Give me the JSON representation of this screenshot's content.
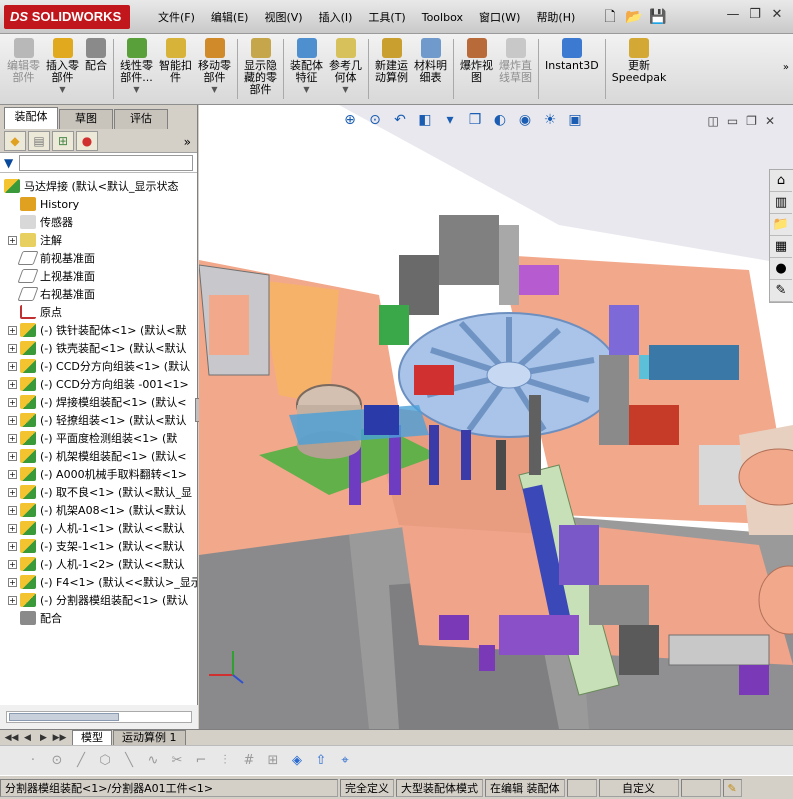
{
  "app": {
    "logo_prefix": "DS",
    "logo_text": "SOLIDWORKS",
    "brand_color": "#c0161c"
  },
  "menu": [
    {
      "id": "file",
      "label": "文件(F)"
    },
    {
      "id": "edit",
      "label": "编辑(E)"
    },
    {
      "id": "view",
      "label": "视图(V)"
    },
    {
      "id": "insert",
      "label": "插入(I)"
    },
    {
      "id": "tools",
      "label": "工具(T)"
    },
    {
      "id": "toolbox",
      "label": "Toolbox"
    },
    {
      "id": "window",
      "label": "窗口(W)"
    },
    {
      "id": "help",
      "label": "帮助(H)"
    }
  ],
  "quick_access": [
    {
      "id": "new",
      "icon": "new-document-icon",
      "glyph": "🗋"
    },
    {
      "id": "open",
      "icon": "open-folder-icon",
      "glyph": "📂"
    },
    {
      "id": "save",
      "icon": "save-icon",
      "glyph": "💾"
    }
  ],
  "window_controls": [
    {
      "id": "minimize",
      "glyph": "—"
    },
    {
      "id": "restore",
      "glyph": "❐"
    },
    {
      "id": "close",
      "glyph": "✕"
    }
  ],
  "toolbar": [
    {
      "id": "edit-component",
      "label": "编辑零\n部件",
      "icon": "edit-component-icon",
      "color": "#b8b8b8",
      "disabled": true
    },
    {
      "id": "insert-components",
      "label": "插入零\n部件",
      "icon": "insert-components-icon",
      "color": "#e1a91e",
      "dropdown": true
    },
    {
      "id": "mate",
      "label": "配合",
      "icon": "mate-paperclip-icon",
      "color": "#8a8a8a"
    },
    {
      "id": "linear-pattern",
      "label": "线性零\n部件...",
      "icon": "linear-pattern-icon",
      "color": "#5aa03a",
      "dropdown": true
    },
    {
      "id": "smart-fasteners",
      "label": "智能扣\n件",
      "icon": "smart-fasteners-icon",
      "color": "#d8b33a"
    },
    {
      "id": "move-component",
      "label": "移动零\n部件",
      "icon": "move-component-icon",
      "color": "#d08a2a",
      "dropdown": true
    },
    {
      "id": "show-hidden",
      "label": "显示隐\n藏的零\n部件",
      "icon": "show-hidden-components-icon",
      "color": "#c6a64a"
    },
    {
      "id": "assembly-features",
      "label": "装配体\n特征",
      "icon": "assembly-features-icon",
      "color": "#4e8fd0",
      "dropdown": true
    },
    {
      "id": "reference-geometry",
      "label": "参考几\n何体",
      "icon": "reference-geometry-icon",
      "color": "#d6c15a",
      "dropdown": true
    },
    {
      "id": "new-motion-study",
      "label": "新建运\n动算例",
      "icon": "motion-study-icon",
      "color": "#c9a030"
    },
    {
      "id": "bill-of-materials",
      "label": "材料明\n细表",
      "icon": "bill-of-materials-icon",
      "color": "#6f9acb"
    },
    {
      "id": "exploded-view",
      "label": "爆炸视\n图",
      "icon": "exploded-view-icon",
      "color": "#b96a39"
    },
    {
      "id": "explode-line-sketch",
      "label": "爆炸直\n线草图",
      "icon": "explode-line-sketch-icon",
      "color": "#c8c8c8",
      "disabled": true
    },
    {
      "id": "instant3d",
      "label": "Instant3D",
      "icon": "instant3d-icon",
      "color": "#3b7ad0"
    },
    {
      "id": "update-speedpak",
      "label": "更新\nSpeedpak",
      "icon": "speedpak-icon",
      "color": "#d4a834"
    }
  ],
  "panel": {
    "tabs": [
      "装配体",
      "草图",
      "评估"
    ],
    "active_tab": 0,
    "icons": [
      {
        "id": "feature-manager",
        "icon": "feature-manager-icon",
        "glyph": "◆",
        "color": "#e0a020"
      },
      {
        "id": "property-manager",
        "icon": "property-manager-icon",
        "glyph": "▤",
        "color": "#7a7a7a"
      },
      {
        "id": "configuration-manager",
        "icon": "configuration-manager-icon",
        "glyph": "⊞",
        "color": "#4a8a4a"
      },
      {
        "id": "display-manager",
        "icon": "display-manager-icon",
        "glyph": "●",
        "color": "#d03030"
      }
    ],
    "expand_glyph": "»"
  },
  "tree": {
    "root": "马达焊接  (默认<默认_显示状态",
    "nodes": [
      {
        "id": "history",
        "label": "History",
        "icon": "history-icon",
        "color": "#e0a020",
        "expand": false
      },
      {
        "id": "sensors",
        "label": "传感器",
        "icon": "sensor-icon",
        "color": "#d8d8d8",
        "expand": false
      },
      {
        "id": "annotations",
        "label": "注解",
        "icon": "annotations-icon",
        "color": "#e8d060",
        "expand": true
      },
      {
        "id": "front-plane",
        "label": "前视基准面",
        "icon": "plane-icon",
        "color": "#c0c0c0",
        "expand": false
      },
      {
        "id": "top-plane",
        "label": "上视基准面",
        "icon": "plane-icon",
        "color": "#c0c0c0",
        "expand": false
      },
      {
        "id": "right-plane",
        "label": "右视基准面",
        "icon": "plane-icon",
        "color": "#c0c0c0",
        "expand": false
      },
      {
        "id": "origin",
        "label": "原点",
        "icon": "origin-icon",
        "color": "#b04040",
        "expand": false
      },
      {
        "id": "c1",
        "label": "(-) 铁针装配体<1> (默认<默",
        "icon": "assembly-icon",
        "color": "#e0a020",
        "expand": true
      },
      {
        "id": "c2",
        "label": "(-) 铁壳装配<1> (默认<默认",
        "icon": "assembly-icon",
        "color": "#e0a020",
        "expand": true
      },
      {
        "id": "c3",
        "label": "(-) CCD分方向组装<1> (默认",
        "icon": "assembly-icon",
        "color": "#e0a020",
        "expand": true
      },
      {
        "id": "c4",
        "label": "(-) CCD分方向组装 -001<1>",
        "icon": "assembly-icon",
        "color": "#e0a020",
        "expand": true
      },
      {
        "id": "c5",
        "label": "(-) 焊接模组装配<1> (默认<",
        "icon": "assembly-icon",
        "color": "#e0a020",
        "expand": true
      },
      {
        "id": "c6",
        "label": "(-) 轻撩组装<1> (默认<默认",
        "icon": "assembly-icon",
        "color": "#e0a020",
        "expand": true
      },
      {
        "id": "c7",
        "label": "(-) 平面度检测组装<1> (默",
        "icon": "assembly-icon",
        "color": "#e0a020",
        "expand": true
      },
      {
        "id": "c8",
        "label": "(-) 机架模组装配<1> (默认<",
        "icon": "assembly-icon",
        "color": "#e0a020",
        "expand": true
      },
      {
        "id": "c9",
        "label": "(-) A000机械手取料翻转<1>",
        "icon": "assembly-icon",
        "color": "#e0a020",
        "expand": true
      },
      {
        "id": "c10",
        "label": "(-) 取不良<1> (默认<默认_显",
        "icon": "assembly-icon",
        "color": "#e0a020",
        "expand": true
      },
      {
        "id": "c11",
        "label": "(-) 机架A08<1> (默认<默认",
        "icon": "part-icon",
        "color": "#e0a020",
        "expand": true
      },
      {
        "id": "c12",
        "label": "(-) 人机-1<1> (默认<<默认",
        "icon": "part-icon",
        "color": "#e0a020",
        "expand": true
      },
      {
        "id": "c13",
        "label": "(-) 支架-1<1> (默认<<默认",
        "icon": "part-icon",
        "color": "#e0a020",
        "expand": true
      },
      {
        "id": "c14",
        "label": "(-) 人机-1<2> (默认<<默认",
        "icon": "part-icon",
        "color": "#e0a020",
        "expand": true
      },
      {
        "id": "c15",
        "label": "(-) F4<1> (默认<<默认>_显示",
        "icon": "part-icon",
        "color": "#e0a020",
        "expand": true
      },
      {
        "id": "c16",
        "label": "(-) 分割器模组装配<1> (默认",
        "icon": "assembly-icon",
        "color": "#e0a020",
        "expand": true
      },
      {
        "id": "mates",
        "label": "配合",
        "icon": "mates-icon",
        "color": "#8a8a8a",
        "expand": false
      }
    ]
  },
  "hud_icons": [
    {
      "id": "zoom-to-fit",
      "icon": "zoom-to-fit-icon",
      "glyph": "⊕"
    },
    {
      "id": "zoom-area",
      "icon": "zoom-area-icon",
      "glyph": "⊙"
    },
    {
      "id": "previous-view",
      "icon": "previous-view-icon",
      "glyph": "↶"
    },
    {
      "id": "section-view",
      "icon": "section-view-icon",
      "glyph": "◧"
    },
    {
      "id": "view-orientation",
      "icon": "view-orientation-icon",
      "glyph": "▾"
    },
    {
      "id": "display-style",
      "icon": "display-style-icon",
      "glyph": "❒"
    },
    {
      "id": "hide-show",
      "icon": "hide-show-items-icon",
      "glyph": "◐"
    },
    {
      "id": "edit-appearance",
      "icon": "edit-appearance-icon",
      "glyph": "◉"
    },
    {
      "id": "apply-scene",
      "icon": "apply-scene-icon",
      "glyph": "☀"
    },
    {
      "id": "view-settings",
      "icon": "view-settings-icon",
      "glyph": "▣"
    }
  ],
  "view_controls": [
    {
      "id": "split",
      "glyph": "◫"
    },
    {
      "id": "minimize",
      "glyph": "▭"
    },
    {
      "id": "restore",
      "glyph": "❐"
    },
    {
      "id": "close",
      "glyph": "✕"
    }
  ],
  "task_pane": [
    {
      "id": "home",
      "icon": "home-icon",
      "glyph": "⌂"
    },
    {
      "id": "design-library",
      "icon": "design-library-icon",
      "glyph": "▥"
    },
    {
      "id": "file-explorer",
      "icon": "file-explorer-icon",
      "glyph": "📁"
    },
    {
      "id": "view-palette",
      "icon": "view-palette-icon",
      "glyph": "▦"
    },
    {
      "id": "appearances",
      "icon": "appearances-icon",
      "glyph": "●"
    },
    {
      "id": "custom-properties",
      "icon": "custom-properties-icon",
      "glyph": "✎"
    }
  ],
  "bottom_tabs": [
    "模型",
    "运动算例 1"
  ],
  "bottom_tab_nav": [
    "◀◀",
    "◀",
    "▶",
    "▶▶"
  ],
  "sketch_icons": [
    {
      "id": "point",
      "icon": "point-icon",
      "glyph": "·"
    },
    {
      "id": "circle",
      "icon": "circle-icon",
      "glyph": "⊙"
    },
    {
      "id": "line",
      "icon": "line-icon",
      "glyph": "╱"
    },
    {
      "id": "polygon",
      "icon": "polygon-icon",
      "glyph": "⬡"
    },
    {
      "id": "centerline",
      "icon": "centerline-icon",
      "glyph": "╲"
    },
    {
      "id": "spline",
      "icon": "spline-icon",
      "glyph": "∿"
    },
    {
      "id": "trim",
      "icon": "trim-icon",
      "glyph": "✂"
    },
    {
      "id": "offset",
      "icon": "offset-icon",
      "glyph": "⌐"
    },
    {
      "id": "mirror",
      "icon": "mirror-icon",
      "glyph": "⫶"
    },
    {
      "id": "grid",
      "icon": "grid-icon",
      "glyph": "#"
    },
    {
      "id": "fill",
      "icon": "fill-icon",
      "glyph": "⊞"
    },
    {
      "id": "3d-sketch",
      "icon": "3d-sketch-icon",
      "glyph": "◈",
      "active": true
    },
    {
      "id": "move-entities",
      "icon": "move-entities-icon",
      "glyph": "⇧",
      "active": true
    },
    {
      "id": "smart-dimension",
      "icon": "smart-dimension-icon",
      "glyph": "⌖",
      "active": true
    }
  ],
  "status": {
    "path": "分割器模组装配<1>/分割器A01工件<1>",
    "fully_defined": "完全定义",
    "large_assembly": "大型装配体模式",
    "editing": "在编辑 装配体",
    "custom": "自定义",
    "extra_icon": "✎"
  }
}
